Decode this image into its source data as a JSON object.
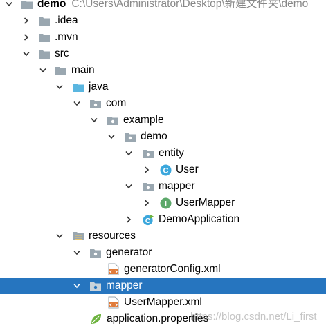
{
  "project": {
    "name": "demo",
    "path": "C:\\Users\\Administrator\\Desktop\\新建文件夹\\demo"
  },
  "items": {
    "idea": ".idea",
    "mvn": ".mvn",
    "src": "src",
    "main": "main",
    "java": "java",
    "com": "com",
    "example": "example",
    "demo_pkg": "demo",
    "entity": "entity",
    "user": "User",
    "mapper_pkg": "mapper",
    "user_mapper": "UserMapper",
    "demo_application": "DemoApplication",
    "resources": "resources",
    "generator": "generator",
    "generator_config": "generatorConfig.xml",
    "mapper_res": "mapper",
    "user_mapper_xml": "UserMapper.xml",
    "application_properties": "application.properties"
  },
  "watermark": "https://blog.csdn.net/Li_first",
  "colors": {
    "selection": "#2675bf",
    "folder": "#9aa7b0",
    "source_folder": "#5ab6e0",
    "class_icon": "#3ba7dc",
    "interface_icon": "#5ca86a"
  }
}
